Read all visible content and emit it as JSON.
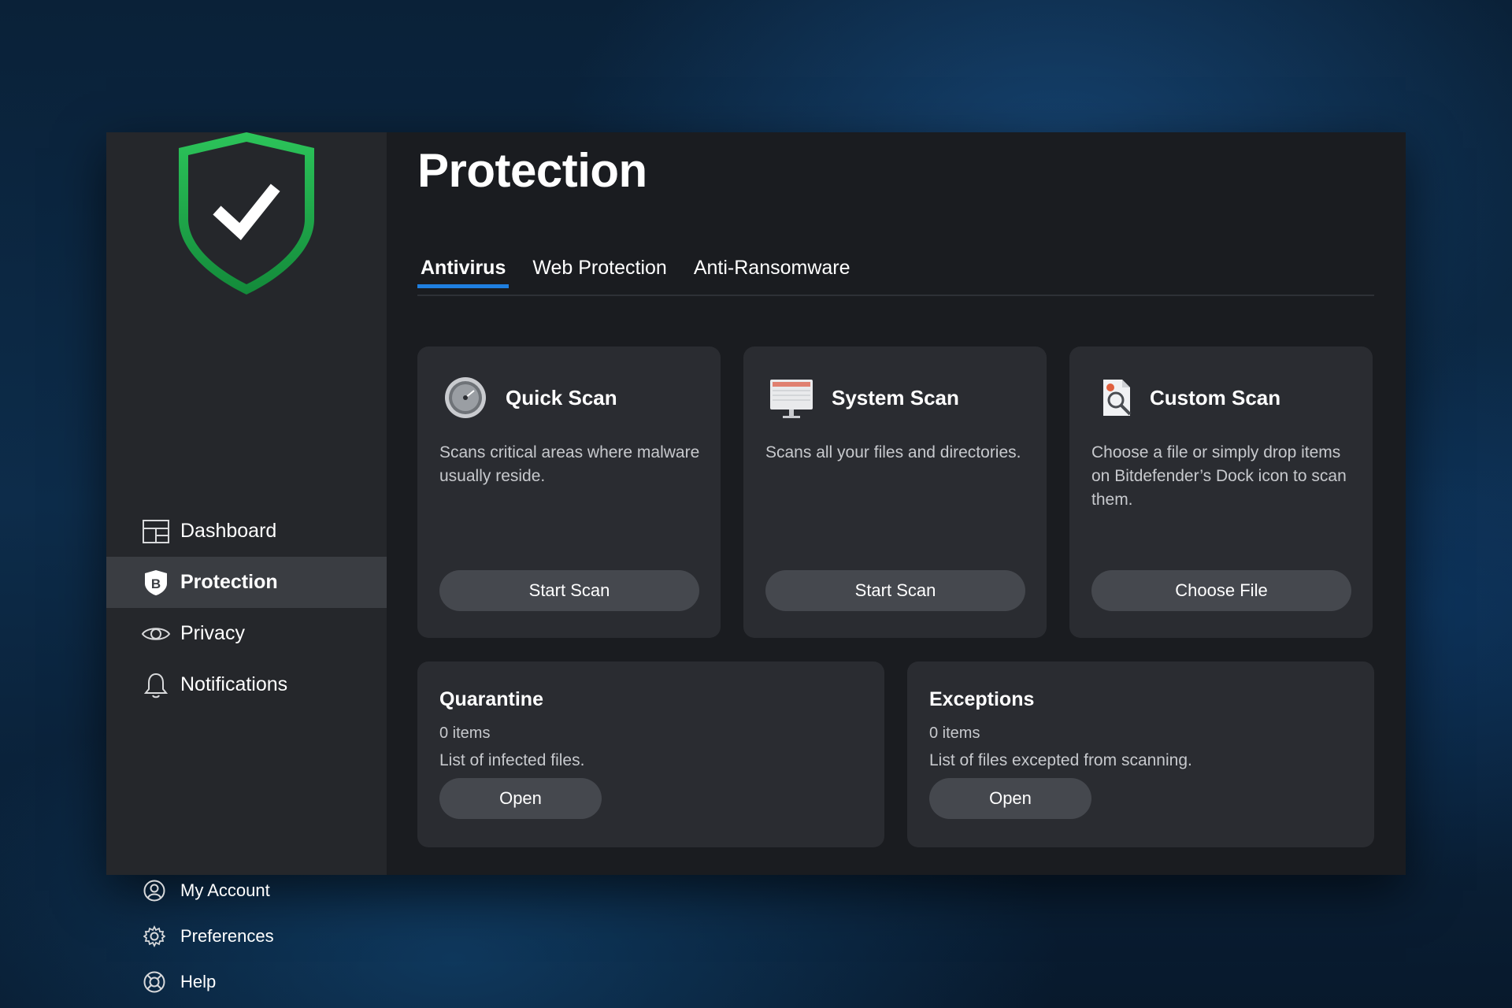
{
  "window": {
    "title": "Protection"
  },
  "sidebar": {
    "logo_icon": "shield-check-icon",
    "nav": [
      {
        "label": "Dashboard",
        "icon": "dashboard-icon",
        "active": false
      },
      {
        "label": "Protection",
        "icon": "bitdefender-shield-icon",
        "active": true
      },
      {
        "label": "Privacy",
        "icon": "eye-icon",
        "active": false
      },
      {
        "label": "Notifications",
        "icon": "bell-icon",
        "active": false
      }
    ],
    "bottom_nav": [
      {
        "label": "My Account",
        "icon": "user-icon"
      },
      {
        "label": "Preferences",
        "icon": "gear-icon"
      },
      {
        "label": "Help",
        "icon": "lifebuoy-icon"
      }
    ]
  },
  "tabs": [
    {
      "label": "Antivirus",
      "active": true
    },
    {
      "label": "Web Protection",
      "active": false
    },
    {
      "label": "Anti-Ransomware",
      "active": false
    }
  ],
  "scans": [
    {
      "title": "Quick Scan",
      "icon": "quick-scan-icon",
      "description": "Scans critical areas where malware usually reside.",
      "button": "Start Scan"
    },
    {
      "title": "System Scan",
      "icon": "system-scan-icon",
      "description": "Scans all your files and directories.",
      "button": "Start Scan"
    },
    {
      "title": "Custom Scan",
      "icon": "custom-scan-icon",
      "description": "Choose a file or simply drop items on Bitdefender’s Dock icon to scan them.",
      "button": "Choose File"
    }
  ],
  "quarantine": {
    "title": "Quarantine",
    "count": "0 items",
    "description": "List of infected files.",
    "button": "Open"
  },
  "exceptions": {
    "title": "Exceptions",
    "count": "0 items",
    "description": "List of files excepted from scanning.",
    "button": "Open"
  },
  "colors": {
    "accent": "#1f7fe0",
    "shield_green": "#22a84a"
  }
}
